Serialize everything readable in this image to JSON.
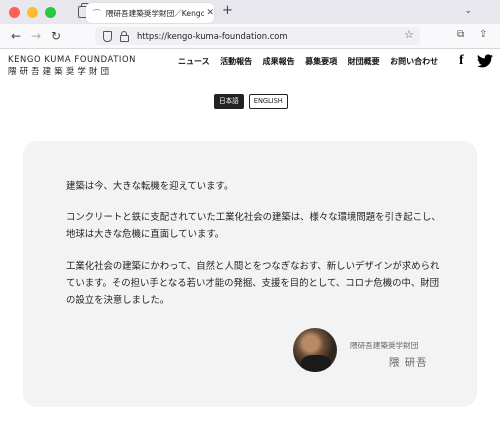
{
  "browser": {
    "tab_title": "隈研吾建築奨学財団／Kengo Kuma",
    "tab_close": "✕",
    "new_tab": "+",
    "tab_menu": "⌄",
    "url": "https://kengo-kuma-foundation.com",
    "icons": [
      "back-icon",
      "forward-icon",
      "reload-icon",
      "shield-icon",
      "lock-icon",
      "star-icon",
      "extensions-icon",
      "share-icon"
    ]
  },
  "site": {
    "logo_en": "KENGO KUMA FOUNDATION",
    "logo_jp": "隈研吾建築奨学財団",
    "nav": [
      "ニュース",
      "活動報告",
      "成果報告",
      "募集要項",
      "財団概要",
      "お問い合わせ"
    ],
    "social": [
      "facebook-icon",
      "twitter-icon"
    ]
  },
  "lang": {
    "jp": "日本語",
    "en": "ENGLISH",
    "active": "jp"
  },
  "message": {
    "p1": "建築は今、大きな転機を迎えています。",
    "p2": "コンクリートと鉄に支配されていた工業化社会の建築は、様々な環境問題を引き起こし、地球は大きな危機に直面しています。",
    "p3": "工業化社会の建築にかわって、自然と人間とをつなぎなおす、新しいデザインが求められています。その担い手となる若い才能の発掘、支援を目的として、コロナ危機の中、財団の設立を決意しました。",
    "signature_org": "隈研吾建築奨学財団",
    "signature_name": "隈 研吾"
  },
  "colors": {
    "card_bg": "#f3f3f3",
    "tabbar_bg": "#e9e7ee",
    "accent_dark": "#222222"
  }
}
